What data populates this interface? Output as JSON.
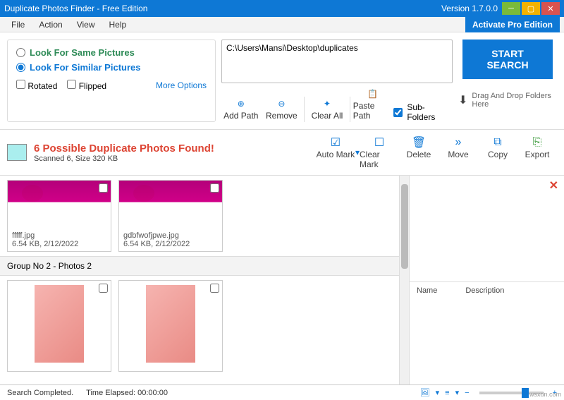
{
  "title": "Duplicate Photos Finder - Free Edition",
  "version": "Version 1.7.0.0",
  "activate": "Activate Pro Edition",
  "menu": {
    "file": "File",
    "action": "Action",
    "view": "View",
    "help": "Help"
  },
  "search_opts": {
    "same": "Look For Same Pictures",
    "similar": "Look For Similar Pictures",
    "rotated": "Rotated",
    "flipped": "Flipped",
    "more": "More Options"
  },
  "path": "C:\\Users\\Mansi\\Desktop\\duplicates",
  "path_tools": {
    "add": "Add Path",
    "remove": "Remove",
    "clear": "Clear All",
    "paste": "Paste Path",
    "subfolders": "Sub-Folders"
  },
  "start": "START SEARCH",
  "drag_hint": "Drag And Drop Folders Here",
  "results": {
    "title": "6 Possible Duplicate Photos Found!",
    "sub": "Scanned 6, Size 320 KB"
  },
  "actions": {
    "automark": "Auto Mark",
    "clearmark": "Clear Mark",
    "delete": "Delete",
    "move": "Move",
    "copy": "Copy",
    "export": "Export"
  },
  "thumbs": [
    {
      "name": "fffff.jpg",
      "meta": "6.54 KB, 2/12/2022"
    },
    {
      "name": "gdbfwofjpwe.jpg",
      "meta": "6.54 KB, 2/12/2022"
    }
  ],
  "group2": "Group No 2  -  Photos 2",
  "detail": {
    "name_h": "Name",
    "desc_h": "Description"
  },
  "status": {
    "completed": "Search Completed.",
    "elapsed_label": "Time Elapsed:",
    "elapsed": "00:00:00"
  },
  "watermark": "wsxdn.com"
}
